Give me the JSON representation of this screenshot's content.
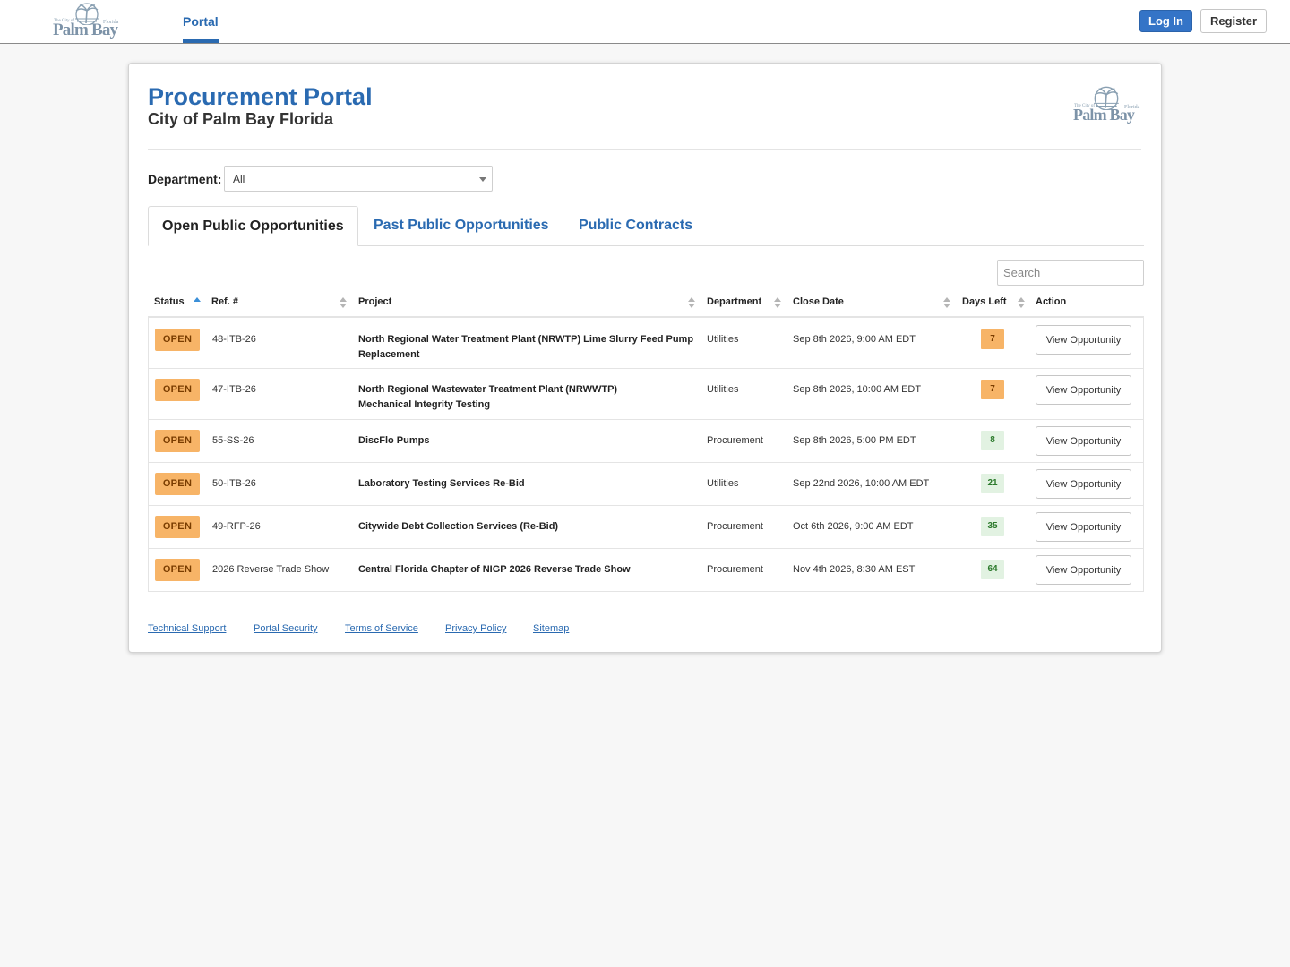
{
  "topnav": {
    "logo": {
      "small_left": "The City of",
      "small_right": "Florida",
      "name": "Palm Bay"
    },
    "portal_label": "Portal",
    "login_label": "Log In",
    "register_label": "Register"
  },
  "header": {
    "title": "Procurement Portal",
    "subtitle": "City of Palm Bay Florida",
    "logo": {
      "small_left": "The City of",
      "small_right": "Florida",
      "name": "Palm Bay"
    }
  },
  "filter": {
    "department_label": "Department:",
    "department_value": "All"
  },
  "tabs": [
    {
      "label": "Open Public Opportunities",
      "active": true
    },
    {
      "label": "Past Public Opportunities",
      "active": false
    },
    {
      "label": "Public Contracts",
      "active": false
    }
  ],
  "search": {
    "placeholder": "Search"
  },
  "table": {
    "columns": [
      "Status",
      "Ref. #",
      "Project",
      "Department",
      "Close Date",
      "Days Left",
      "Action"
    ],
    "rows": [
      {
        "status": "OPEN",
        "ref": "48-ITB-26",
        "project": "North Regional Water Treatment Plant (NRWTP) Lime Slurry Feed Pump Replacement",
        "department": "Utilities",
        "close_date": "Sep 8th 2026, 9:00 AM EDT",
        "days_left": "7",
        "action": "View Opportunity"
      },
      {
        "status": "OPEN",
        "ref": "47-ITB-26",
        "project": "North Regional Wastewater Treatment Plant (NRWWTP) Mechanical Integrity Testing",
        "department": "Utilities",
        "close_date": "Sep 8th 2026, 10:00 AM EDT",
        "days_left": "7",
        "action": "View Opportunity"
      },
      {
        "status": "OPEN",
        "ref": "55-SS-26",
        "project": "DiscFlo Pumps",
        "department": "Procurement",
        "close_date": "Sep 8th 2026, 5:00 PM EDT",
        "days_left": "8",
        "action": "View Opportunity"
      },
      {
        "status": "OPEN",
        "ref": "50-ITB-26",
        "project": "Laboratory Testing Services Re-Bid",
        "department": "Utilities",
        "close_date": "Sep 22nd 2026, 10:00 AM EDT",
        "days_left": "21",
        "action": "View Opportunity"
      },
      {
        "status": "OPEN",
        "ref": "49-RFP-26",
        "project": "Citywide Debt Collection Services (Re-Bid)",
        "department": "Procurement",
        "close_date": "Oct 6th 2026, 9:00 AM EDT",
        "days_left": "35",
        "action": "View Opportunity"
      },
      {
        "status": "OPEN",
        "ref": "2026 Reverse Trade Show",
        "project": "Central Florida Chapter of NIGP 2026 Reverse Trade Show",
        "department": "Procurement",
        "close_date": "Nov 4th 2026, 8:30 AM EST",
        "days_left": "64",
        "action": "View Opportunity"
      }
    ]
  },
  "footer": {
    "links": [
      "Technical Support",
      "Portal Security",
      "Terms of Service",
      "Privacy Policy",
      "Sitemap"
    ]
  },
  "colors": {
    "brand_blue": "#2a6ab1",
    "status_open": "#f7b467",
    "days_urgent": "#f7b467",
    "days_ok": "#e2f2e2"
  }
}
